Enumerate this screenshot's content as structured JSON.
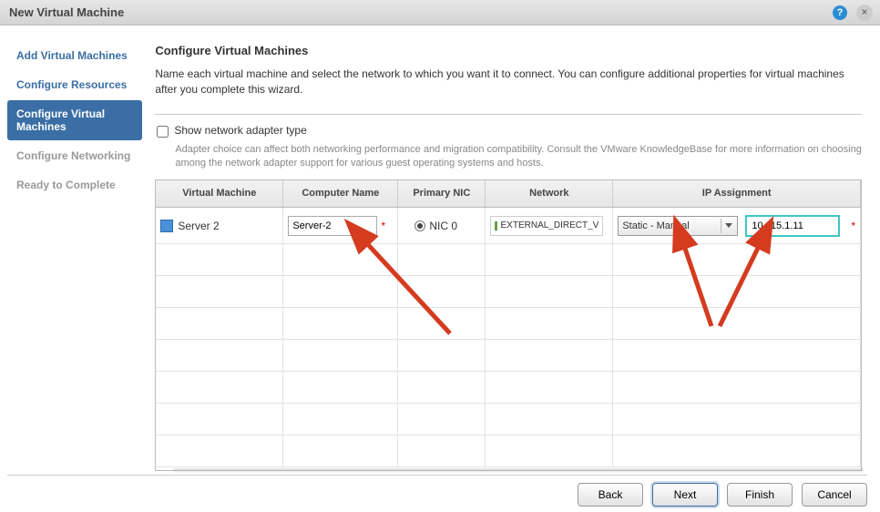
{
  "window": {
    "title": "New Virtual Machine"
  },
  "sidebar": {
    "items": [
      {
        "label": "Add Virtual Machines",
        "state": "done"
      },
      {
        "label": "Configure Resources",
        "state": "done"
      },
      {
        "label": "Configure Virtual Machines",
        "state": "active"
      },
      {
        "label": "Configure Networking",
        "state": "pending"
      },
      {
        "label": "Ready to Complete",
        "state": "pending"
      }
    ]
  },
  "page": {
    "heading": "Configure Virtual Machines",
    "description": "Name each virtual machine and select the network to which you want it to connect. You can configure additional properties for virtual machines after you complete this wizard.",
    "show_adapter_label": "Show network adapter type",
    "adapter_hint": "Adapter choice can affect both networking performance and migration compatibility. Consult the VMware KnowledgeBase for more information on choosing among the network adapter support for various guest operating systems and hosts."
  },
  "grid": {
    "headers": {
      "vm": "Virtual Machine",
      "computer_name": "Computer Name",
      "primary_nic": "Primary NIC",
      "network": "Network",
      "ip_assignment": "IP Assignment"
    },
    "rows": [
      {
        "vm_name": "Server 2",
        "computer_name": "Server-2",
        "primary_nic": "NIC 0",
        "network": "EXTERNAL_DIRECT_V",
        "ip_mode": "Static - Manual",
        "ip_address": "10.115.1.11"
      }
    ]
  },
  "buttons": {
    "back": "Back",
    "next": "Next",
    "finish": "Finish",
    "cancel": "Cancel"
  }
}
